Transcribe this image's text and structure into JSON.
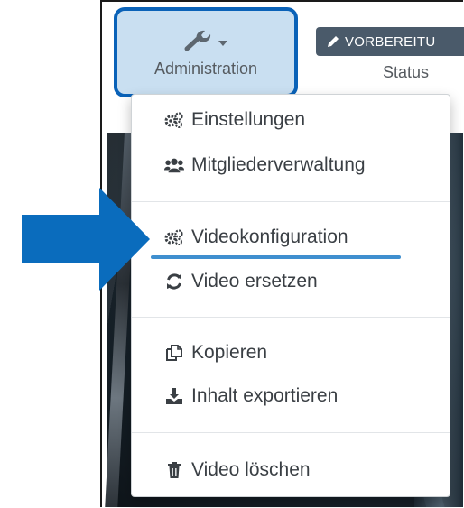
{
  "toolbar": {
    "administration_label": "Administration",
    "status_badge": "VORBEREITU",
    "status_label": "Status"
  },
  "menu": {
    "items": [
      {
        "label": "Einstellungen",
        "icon": "gears-icon"
      },
      {
        "label": "Mitgliederverwaltung",
        "icon": "users-icon"
      },
      {
        "label": "Videokonfiguration",
        "icon": "gears-icon"
      },
      {
        "label": "Video ersetzen",
        "icon": "refresh-icon"
      },
      {
        "label": "Kopieren",
        "icon": "copy-icon"
      },
      {
        "label": "Inhalt exportieren",
        "icon": "download-icon"
      },
      {
        "label": "Video löschen",
        "icon": "trash-icon"
      }
    ]
  },
  "colors": {
    "highlight_border": "#0a62b8",
    "highlight_fill": "#c9dff1",
    "arrow": "#0a6cbd",
    "underline": "#3f8fcf",
    "badge": "#4a5a6a"
  }
}
